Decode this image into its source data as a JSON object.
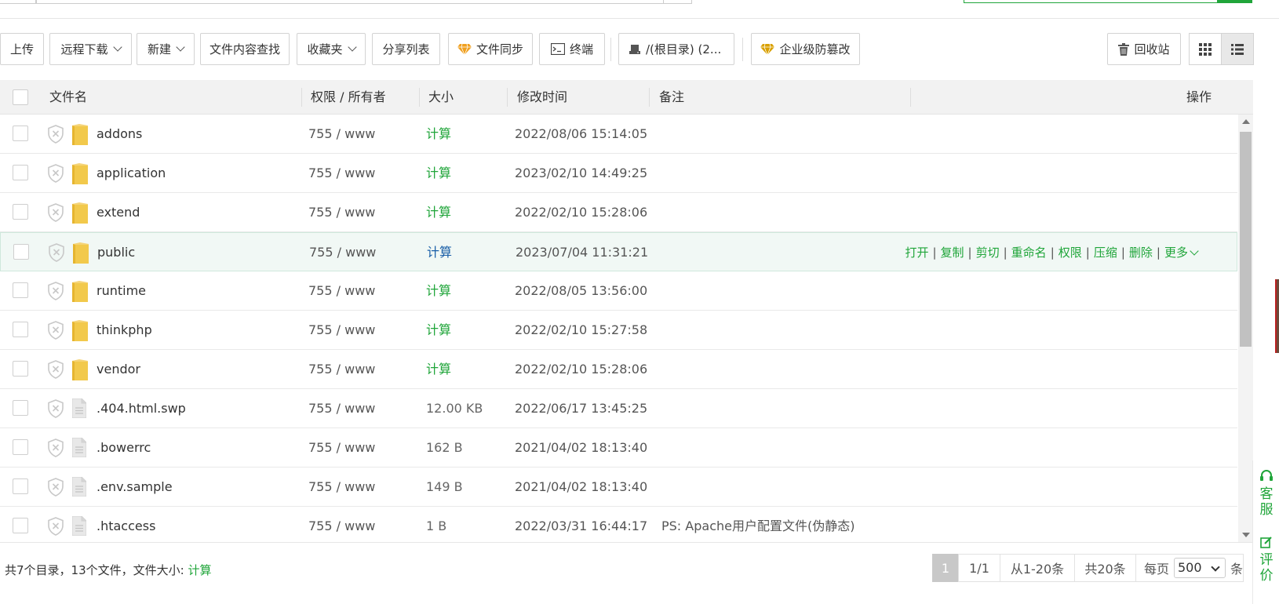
{
  "toolbar": {
    "upload": "上传",
    "remote_download": "远程下载",
    "new": "新建",
    "content_search": "文件内容查找",
    "favorites": "收藏夹",
    "share_list": "分享列表",
    "file_sync": "文件同步",
    "terminal": "终端",
    "path": "/(根目录) (2...",
    "tamper_protect": "企业级防篡改",
    "recycle_bin": "回收站"
  },
  "columns": {
    "name": "文件名",
    "perm": "权限 / 所有者",
    "size": "大小",
    "mtime": "修改时间",
    "note": "备注",
    "ops": "操作"
  },
  "rows": [
    {
      "name": "addons",
      "type": "folder",
      "perm": "755 / www",
      "size": "计算",
      "mtime": "2022/08/06 15:14:05",
      "note": ""
    },
    {
      "name": "application",
      "type": "folder",
      "perm": "755 / www",
      "size": "计算",
      "mtime": "2023/02/10 14:49:25",
      "note": ""
    },
    {
      "name": "extend",
      "type": "folder",
      "perm": "755 / www",
      "size": "计算",
      "mtime": "2022/02/10 15:28:06",
      "note": ""
    },
    {
      "name": "public",
      "type": "folder",
      "perm": "755 / www",
      "size": "计算",
      "mtime": "2023/07/04 11:31:21",
      "note": "",
      "hover": true
    },
    {
      "name": "runtime",
      "type": "folder",
      "perm": "755 / www",
      "size": "计算",
      "mtime": "2022/08/05 13:56:00",
      "note": ""
    },
    {
      "name": "thinkphp",
      "type": "folder",
      "perm": "755 / www",
      "size": "计算",
      "mtime": "2022/02/10 15:27:58",
      "note": ""
    },
    {
      "name": "vendor",
      "type": "folder",
      "perm": "755 / www",
      "size": "计算",
      "mtime": "2022/02/10 15:28:06",
      "note": ""
    },
    {
      "name": ".404.html.swp",
      "type": "file",
      "perm": "755 / www",
      "size": "12.00 KB",
      "mtime": "2022/06/17 13:45:25",
      "note": ""
    },
    {
      "name": ".bowerrc",
      "type": "file",
      "perm": "755 / www",
      "size": "162 B",
      "mtime": "2021/04/02 18:13:40",
      "note": ""
    },
    {
      "name": ".env.sample",
      "type": "file",
      "perm": "755 / www",
      "size": "149 B",
      "mtime": "2021/04/02 18:13:40",
      "note": ""
    },
    {
      "name": ".htaccess",
      "type": "file",
      "perm": "755 / www",
      "size": "1 B",
      "mtime": "2022/03/31 16:44:17",
      "note": "PS: Apache用户配置文件(伪静态)"
    }
  ],
  "row_ops": [
    "打开",
    "复制",
    "剪切",
    "重命名",
    "权限",
    "压缩",
    "删除",
    "更多"
  ],
  "footer": {
    "summary_prefix": "共7个目录，13个文件，文件大小:",
    "summary_calc": "计算",
    "page_current": "1",
    "page_total": "1/1",
    "range": "从1-20条",
    "total": "共20条",
    "per_page_label": "每页",
    "per_page_value": "500",
    "per_page_unit": "条"
  },
  "side": {
    "service_label": "客服",
    "rate_label": "评价"
  },
  "colors": {
    "accent": "#20a53a",
    "hover_size": "#1a5fa8",
    "row_hover_bg": "#f1f8f5"
  },
  "icons": [
    "chevron-down-icon",
    "diamond-icon",
    "terminal-icon",
    "disk-icon",
    "trash-icon",
    "grid-view-icon",
    "list-view-icon",
    "shield-icon",
    "folder-icon",
    "file-icon",
    "headset-icon",
    "edit-icon"
  ]
}
